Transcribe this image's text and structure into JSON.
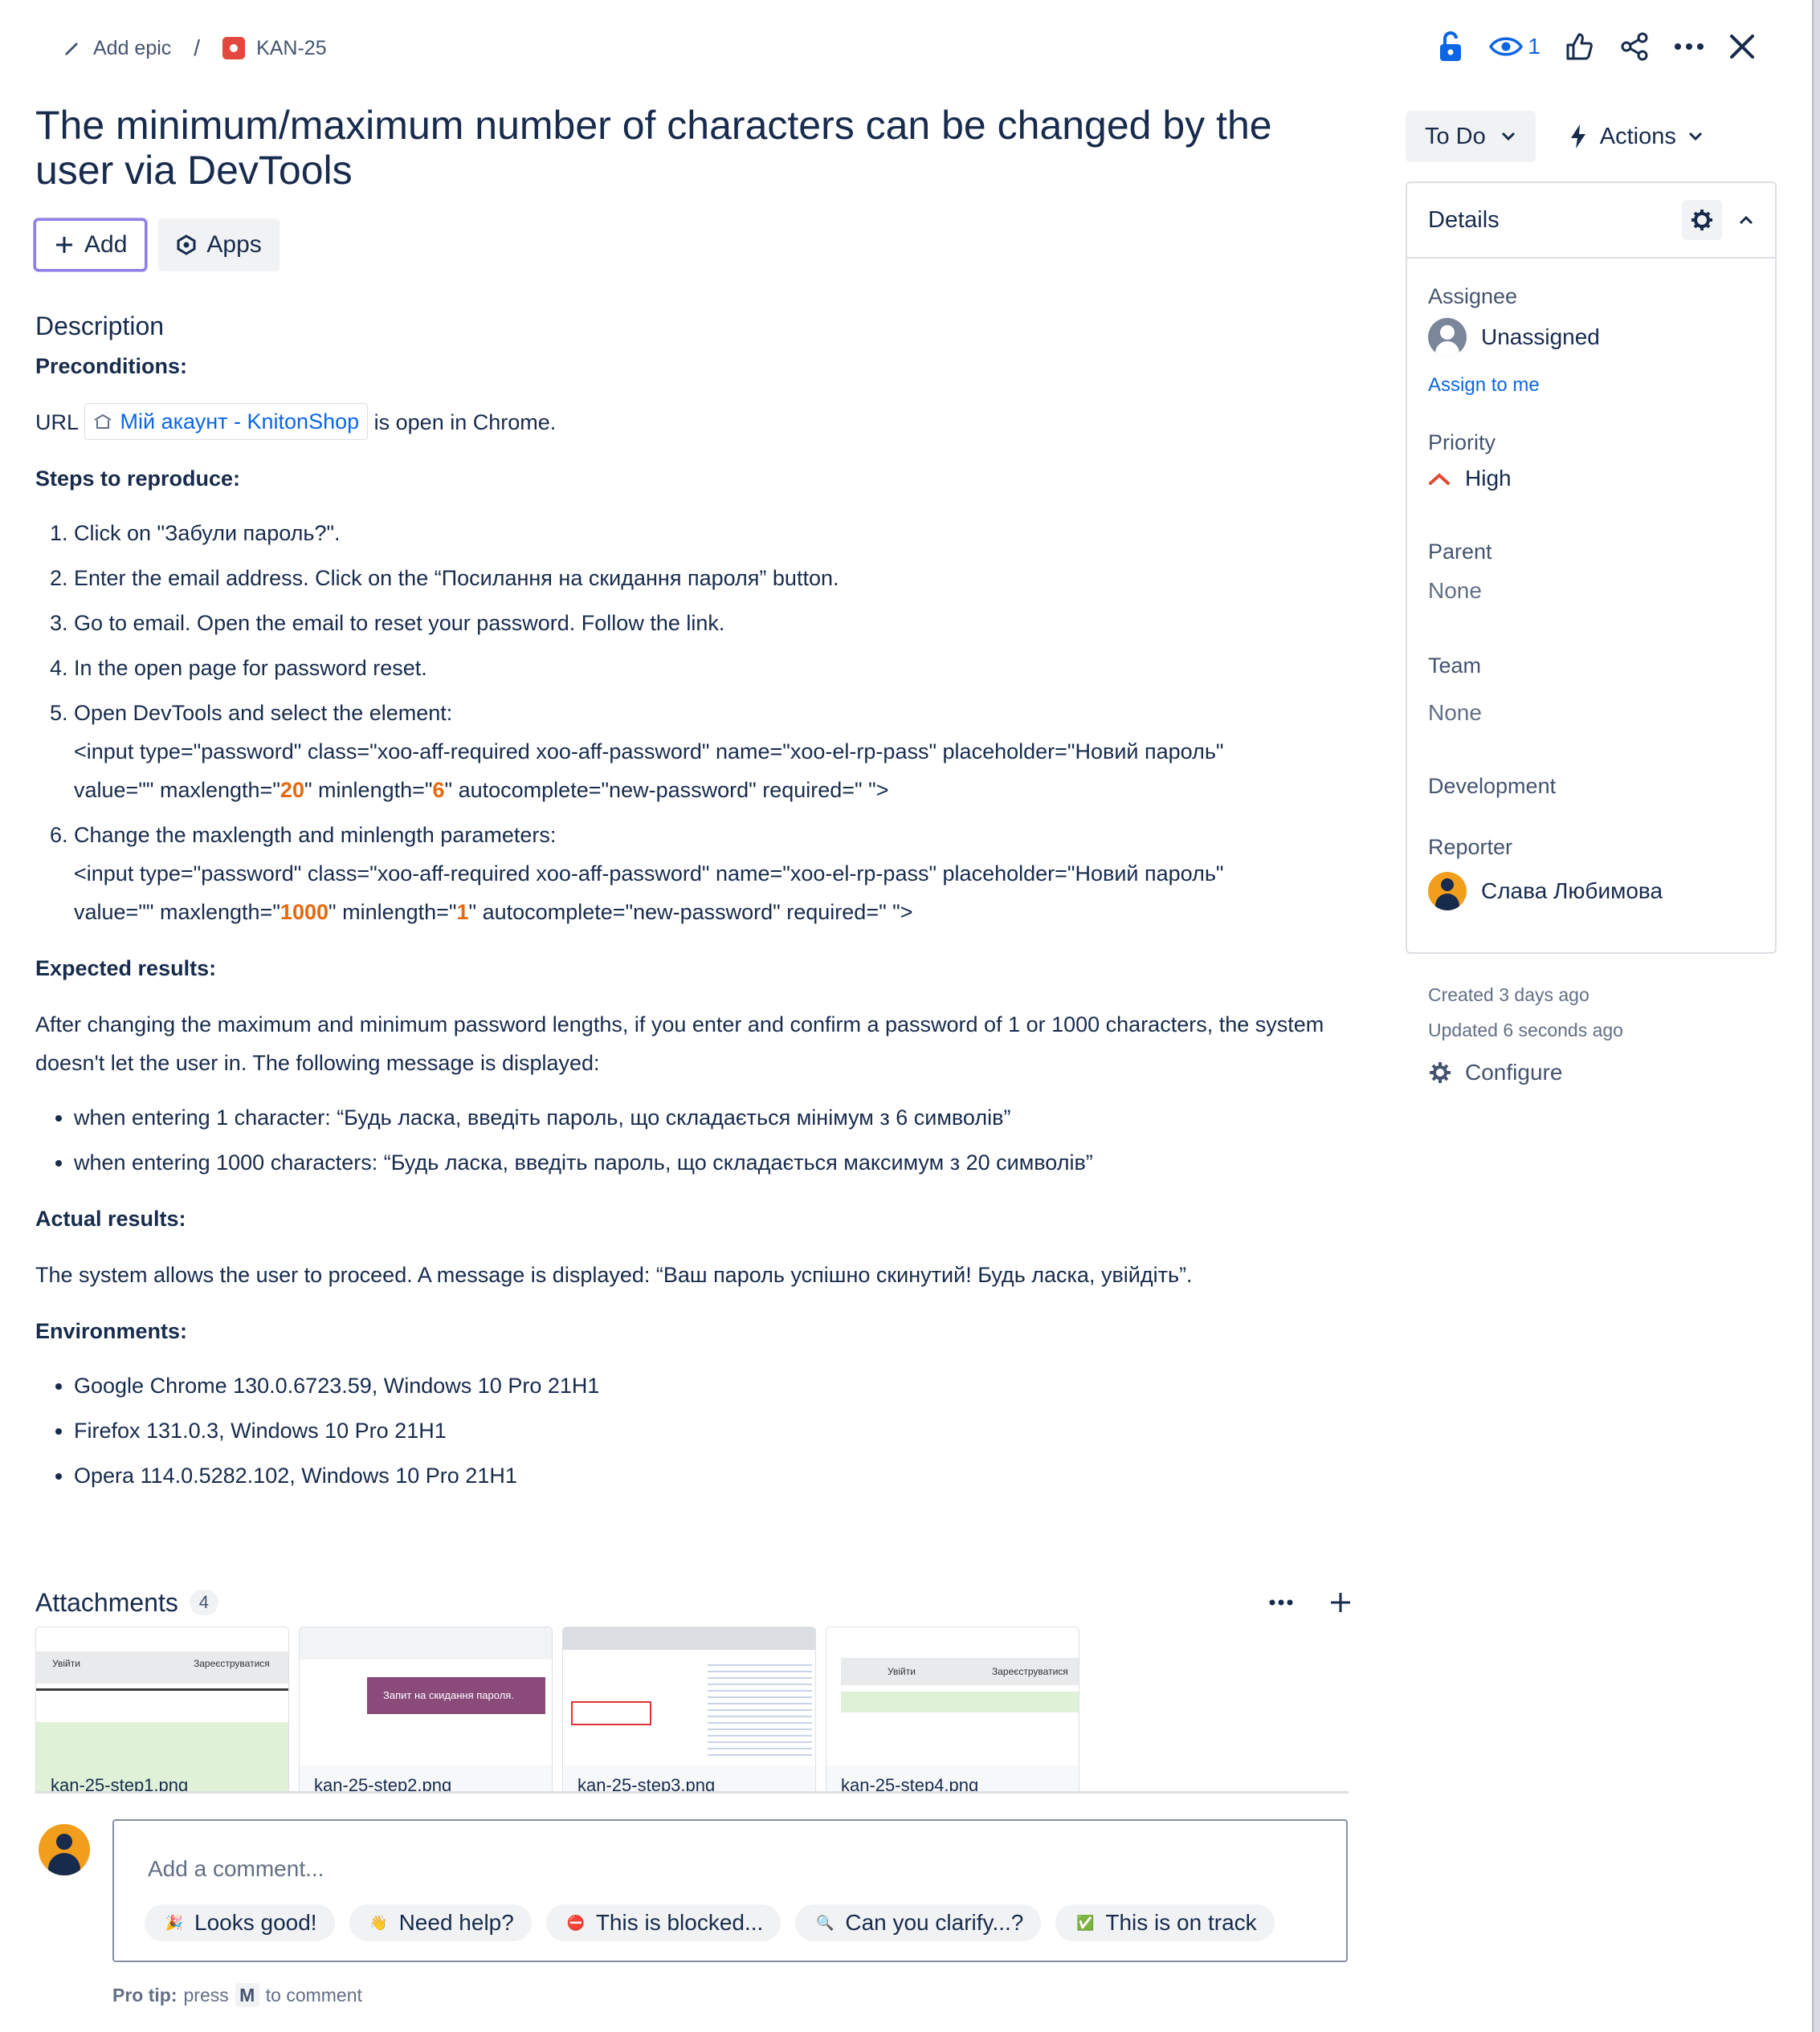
{
  "breadcrumb": {
    "epic": "Add epic",
    "separator": "/",
    "issue_key": "KAN-25"
  },
  "toolbar": {
    "watch_count": "1"
  },
  "issue": {
    "title": "The minimum/maximum number of characters can be changed by the user via DevTools",
    "add_label": "Add",
    "apps_label": "Apps"
  },
  "description": {
    "heading": "Description",
    "preconditions_label": "Preconditions:",
    "url_prefix": "URL",
    "url_link": "Мій акаунт - KnitonShop",
    "url_suffix": "is open in Chrome.",
    "steps_label": "Steps to reproduce:",
    "steps": [
      "Click on \"Забули пароль?\".",
      "Enter the email address. Click on the “Посилання на скидання пароля” button.",
      "Go to email. Open the email to reset your password. Follow the link.",
      "In the open page for password reset.",
      "Open DevTools and select the element:",
      "Change the maxlength and minlength parameters:"
    ],
    "code1_line1": "<input type=\"password\" class=\"xoo-aff-required xoo-aff-password\" name=\"xoo-el-rp-pass\" placeholder=\"Новий пароль\"",
    "code1_a": "value=\"\" maxlength=\"",
    "code1_max": "20",
    "code1_b": "\" minlength=\"",
    "code1_min": "6",
    "code1_c": "\" autocomplete=\"new-password\" required=\"  \">",
    "code2_line1": "<input type=\"password\" class=\"xoo-aff-required xoo-aff-password\" name=\"xoo-el-rp-pass\" placeholder=\"Новий пароль\"",
    "code2_a": "value=\"\" maxlength=\"",
    "code2_max": "1000",
    "code2_b": "\" minlength=\"",
    "code2_min": "1",
    "code2_c": "\" autocomplete=\"new-password\" required=\"  \">",
    "expected_label": "Expected results:",
    "expected_text": "After changing the maximum and minimum password lengths, if you enter and confirm a password of 1 or 1000 characters, the system doesn't let the user in. The following message is displayed:",
    "expected_items": [
      "when entering 1 character: “Будь ласка, введіть пароль, що складається мінімум з 6 символів”",
      "when entering 1000 characters: “Будь ласка, введіть пароль, що складається максимум з 20 символів”"
    ],
    "actual_label": "Actual results:",
    "actual_text": "The system allows the user to proceed. A message is displayed: “Ваш пароль успішно скинутий! Будь ласка, увійдіть”.",
    "env_label": "Environments:",
    "environments": [
      "Google Chrome 130.0.6723.59, Windows 10 Pro 21H1",
      "Firefox 131.0.3, Windows 10 Pro 21H1",
      "Opera 114.0.5282.102, Windows 10 Pro 21H1"
    ]
  },
  "attachments": {
    "title": "Attachments",
    "count": "4",
    "files": [
      "kan-25-step1.png",
      "kan-25-step2.png",
      "kan-25-step3.png",
      "kan-25-step4.png"
    ],
    "thumb_text": {
      "t1_tab_a": "Увійти",
      "t1_tab_b": "Зареєструватися",
      "t2_banner": "Запит на скидання пароля.",
      "t4_tab_a": "Увійти",
      "t4_tab_b": "Зареєструватися"
    }
  },
  "comment": {
    "placeholder": "Add a comment...",
    "quick_replies": [
      {
        "emoji": "🎉",
        "label": "Looks good!"
      },
      {
        "emoji": "👋",
        "label": "Need help?"
      },
      {
        "emoji": "⛔",
        "label": "This is blocked..."
      },
      {
        "emoji": "🔍",
        "label": "Can you clarify...?"
      },
      {
        "emoji": "✅",
        "label": "This is on track"
      }
    ],
    "protip_bold": "Pro tip:",
    "protip_press": "press",
    "protip_key": "M",
    "protip_tail": "to comment"
  },
  "sidebar": {
    "status": "To Do",
    "actions": "Actions",
    "details_title": "Details",
    "assignee_label": "Assignee",
    "assignee_value": "Unassigned",
    "assign_to_me": "Assign to me",
    "priority_label": "Priority",
    "priority_value": "High",
    "priority_color": "#e34935",
    "parent_label": "Parent",
    "parent_value": "None",
    "team_label": "Team",
    "team_value": "None",
    "development_label": "Development",
    "reporter_label": "Reporter",
    "reporter_value": "Слава Любимова",
    "created": "Created 3 days ago",
    "updated": "Updated 6 seconds ago",
    "configure": "Configure"
  },
  "colors": {
    "accent": "#0c66e4",
    "highlight": "#e56910",
    "text": "#172b4d"
  }
}
